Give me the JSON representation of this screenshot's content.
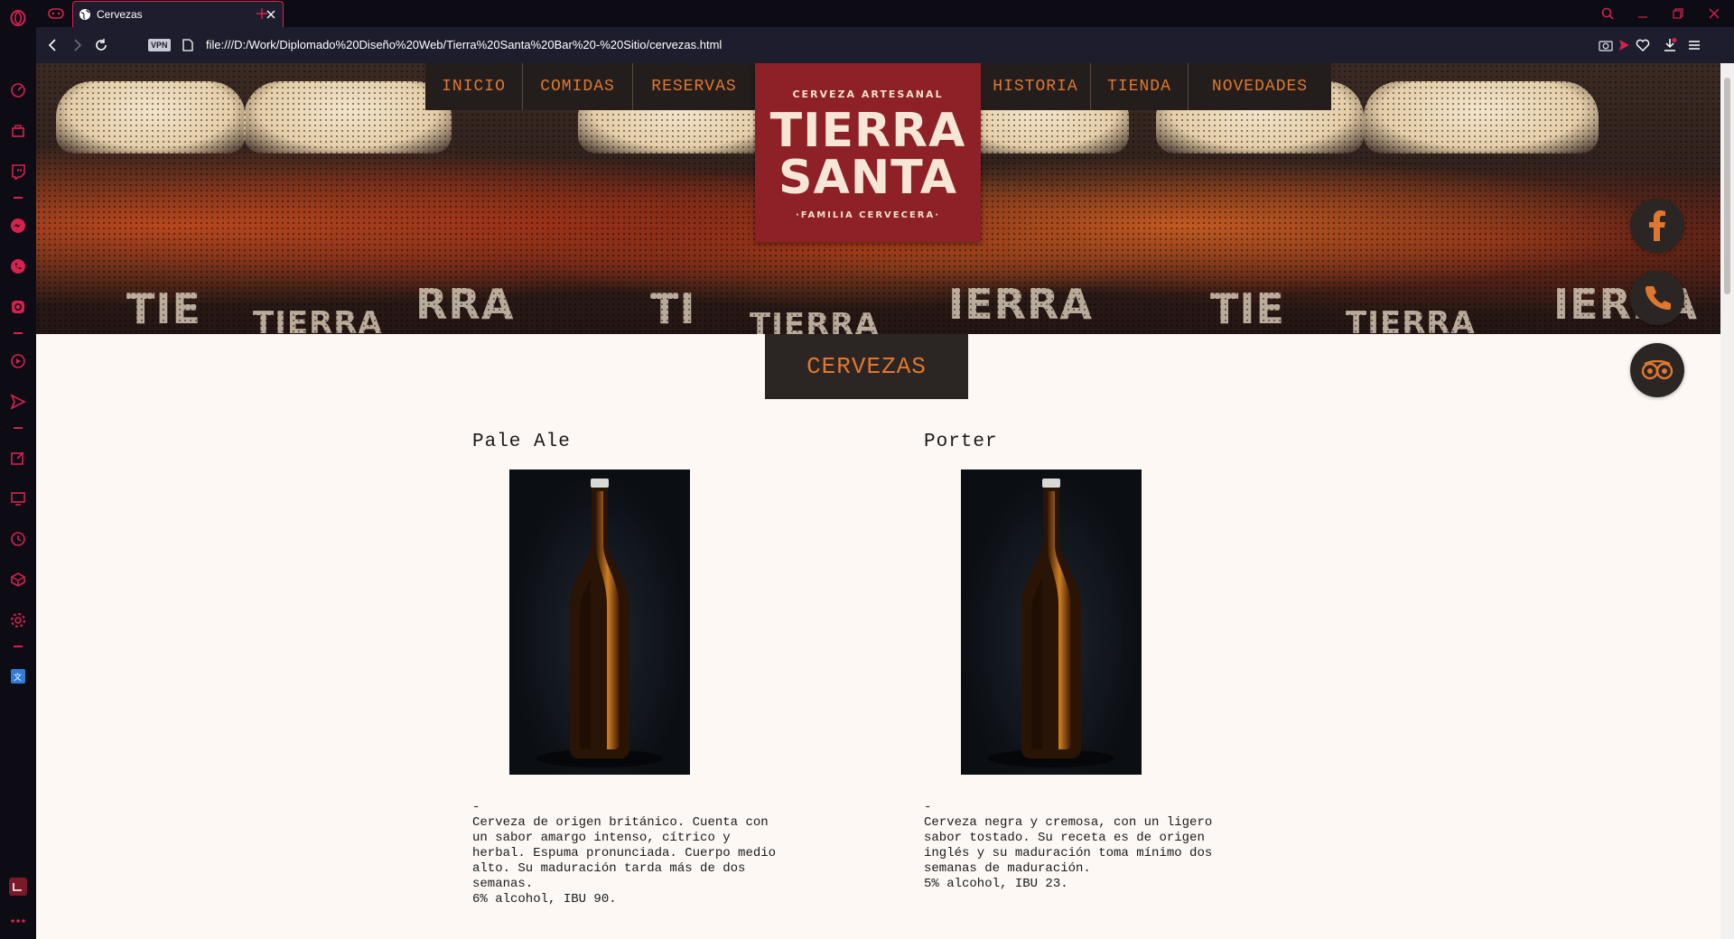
{
  "browser": {
    "tab_title": "Cervezas",
    "vpn_label": "VPN",
    "url": "file:///D:/Work/Diplomado%20Diseño%20Web/Tierra%20Santa%20Bar%20-%20Sitio/cervezas.html"
  },
  "nav": {
    "left": [
      "INICIO",
      "COMIDAS",
      "RESERVAS"
    ],
    "right": [
      "HISTORIA",
      "TIENDA",
      "NOVEDADES"
    ]
  },
  "logo": {
    "top": "CERVEZA ARTESANAL",
    "line1": "TIERRA",
    "line2": "SANTA",
    "bottom": "·FAMILIA CERVECERA·"
  },
  "section_title": "CERVEZAS",
  "beers": [
    {
      "name": "Pale Ale",
      "desc": "-\nCerveza de origen británico. Cuenta con\nun sabor amargo intenso, cítrico y\nherbal. Espuma pronunciada. Cuerpo medio\nalto. Su maduración tarda más de dos\nsemanas.\n6% alcohol, IBU 90."
    },
    {
      "name": "Porter",
      "desc": "-\nCerveza negra y cremosa, con un ligero\nsabor tostado. Su receta es de origen\ninglés y su maduración toma mínimo dos\nsemanas de maduración.\n5% alcohol, IBU 23."
    }
  ],
  "colors": {
    "accent": "#e0772f",
    "dark": "#2b2624",
    "logo_bg": "#8e2127",
    "browser_accent": "#d4234f"
  }
}
